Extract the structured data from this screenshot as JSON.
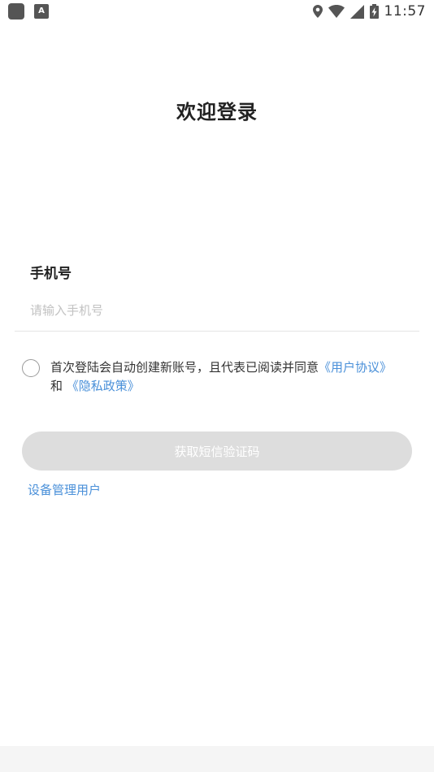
{
  "status_bar": {
    "time": "11:57",
    "left_icons": [
      "app-square-icon",
      "text-a-icon"
    ],
    "right_icons": [
      "location-icon",
      "wifi-icon",
      "signal-icon",
      "battery-charging-icon"
    ],
    "icon_color": "#555555"
  },
  "page": {
    "title": "欢迎登录"
  },
  "phone": {
    "label": "手机号",
    "value": "",
    "placeholder": "请输入手机号"
  },
  "agreement": {
    "checked": false,
    "text_before": "首次登陆会自动创建新账号，且代表已阅读并同意",
    "user_agreement_link": "《用户协议》",
    "and_text": "和",
    "privacy_policy_link": "《隐私政策》",
    "link_color": "#4a90d9"
  },
  "actions": {
    "get_sms_code_label": "获取短信验证码",
    "device_manage_link": "设备管理用户",
    "button_disabled_color": "#dddddd"
  }
}
